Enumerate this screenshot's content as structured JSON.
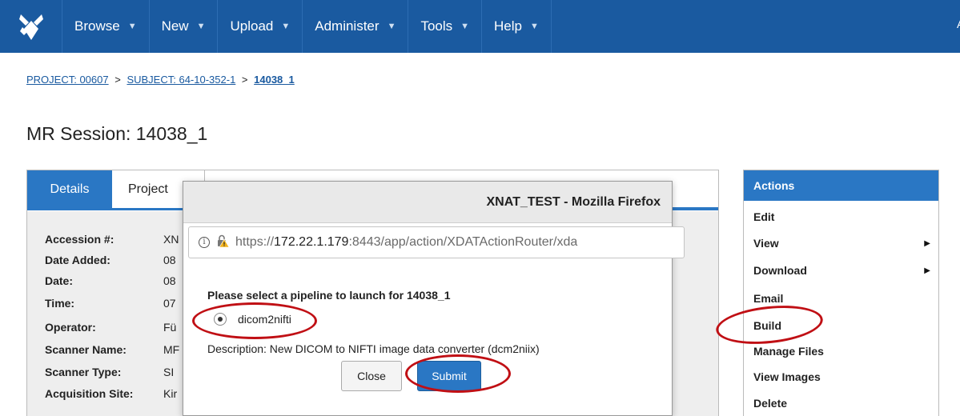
{
  "nav": {
    "items": [
      {
        "label": "Browse"
      },
      {
        "label": "New"
      },
      {
        "label": "Upload"
      },
      {
        "label": "Administer"
      },
      {
        "label": "Tools"
      },
      {
        "label": "Help"
      }
    ],
    "edge_fragment": "A"
  },
  "breadcrumb": {
    "project": "PROJECT: 00607",
    "subject": "SUBJECT: 64-10-352-1",
    "current": "14038_1",
    "separator": ">"
  },
  "page_title": "MR Session: 14038_1",
  "tabs": {
    "details": "Details",
    "projects": "Project"
  },
  "details": {
    "fields": [
      {
        "label": "Accession #:",
        "value": "XN"
      },
      {
        "label": "Date Added:",
        "value": "08"
      },
      {
        "label": "Date:",
        "value": "08"
      },
      {
        "label": "Time:",
        "value": "07"
      },
      {
        "label": "Operator:",
        "value": "Fü"
      },
      {
        "label": "Scanner Name:",
        "value": "MF"
      },
      {
        "label": "Scanner Type:",
        "value": "SI"
      },
      {
        "label": "Acquisition Site:",
        "value": "Kir"
      }
    ]
  },
  "actions": {
    "header": "Actions",
    "items": [
      {
        "label": "Edit"
      },
      {
        "label": "View",
        "submenu": true
      },
      {
        "label": "Download",
        "submenu": true
      },
      {
        "label": "Email"
      },
      {
        "label": "Build"
      },
      {
        "label": "Manage Files"
      },
      {
        "label": "View Images"
      },
      {
        "label": "Delete"
      }
    ]
  },
  "popup": {
    "window_title": "XNAT_TEST - Mozilla Firefox",
    "url_prefix": "https://",
    "url_host": "172.22.1.179",
    "url_rest": ":8443/app/action/XDATActionRouter/xda",
    "prompt": "Please select a pipeline to launch for 14038_1",
    "pipeline_option": "dicom2nifti",
    "pipeline_selected": true,
    "description": "Description: New DICOM to NIFTI image data converter (dcm2niix)",
    "close_label": "Close",
    "submit_label": "Submit"
  },
  "colors": {
    "nav_bg": "#1a5aa0",
    "accent": "#2a77c4",
    "annotation": "#c00f14"
  }
}
